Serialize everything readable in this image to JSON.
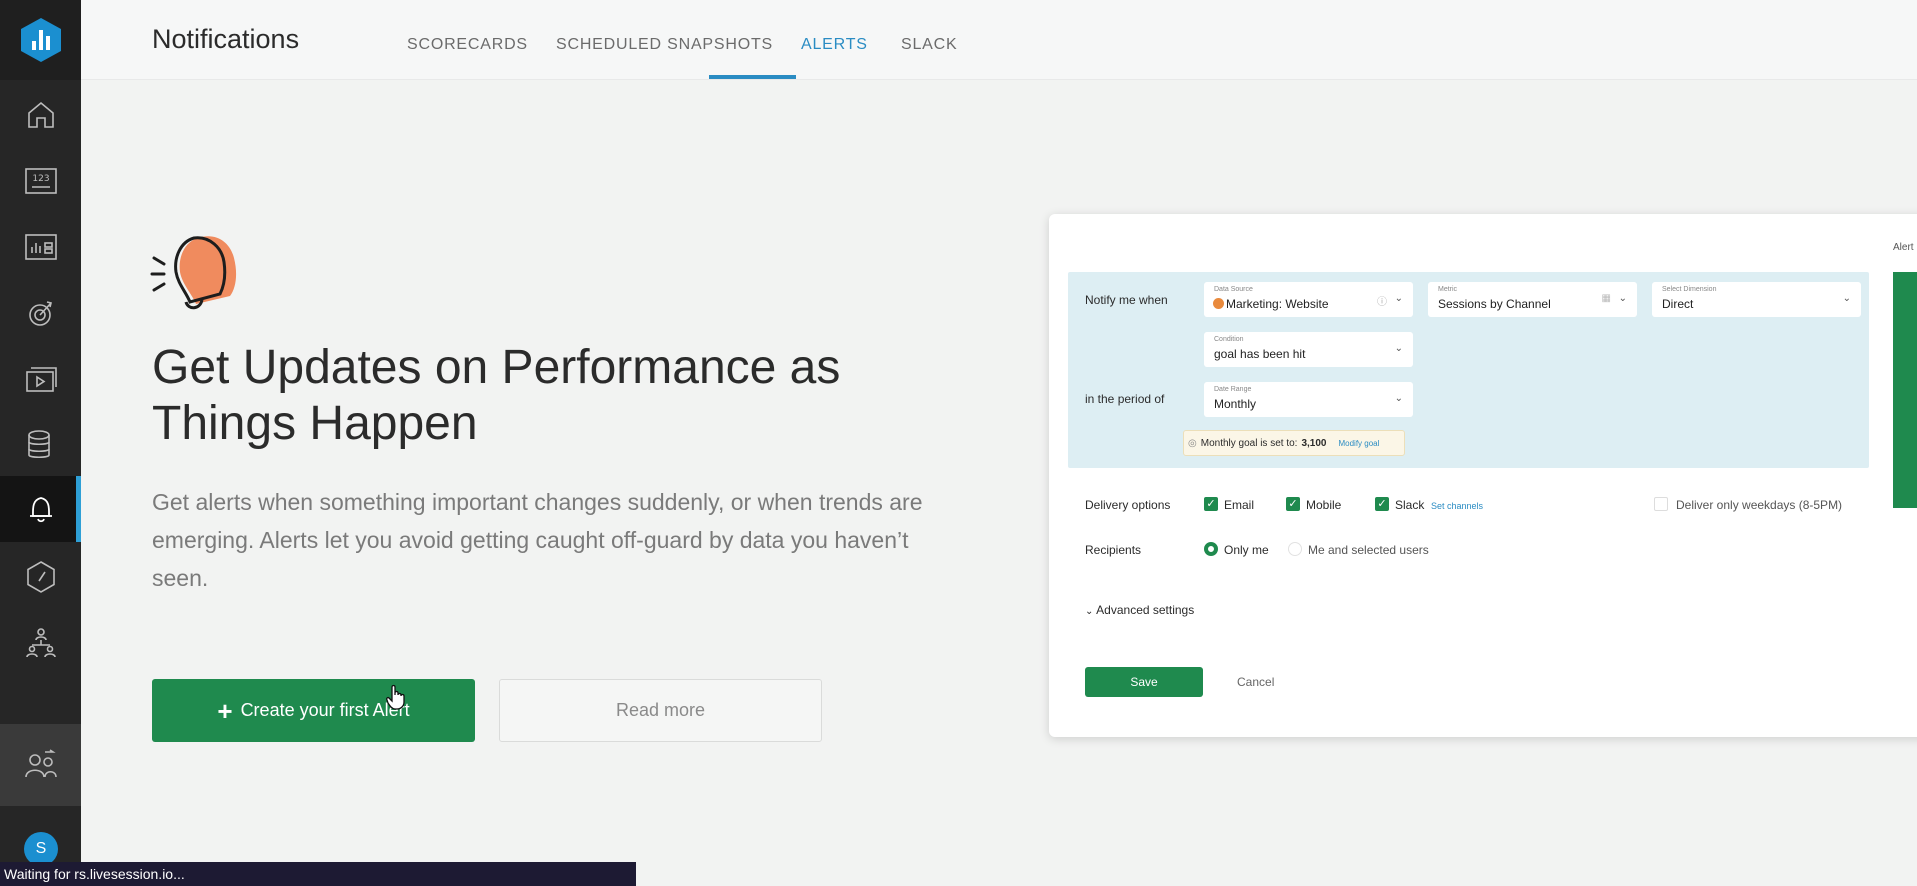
{
  "header": {
    "title": "Notifications",
    "tabs": [
      {
        "label": "SCORECARDS"
      },
      {
        "label": "SCHEDULED SNAPSHOTS"
      },
      {
        "label": "ALERTS"
      },
      {
        "label": "SLACK"
      }
    ],
    "active_tab": "ALERTS"
  },
  "sidebar": {
    "items": [
      "home-icon",
      "number-icon",
      "dashboard-icon",
      "goal-icon",
      "media-icon",
      "database-icon",
      "bell-icon",
      "gauge-icon",
      "org-chart-icon",
      "people-icon"
    ],
    "active": "bell-icon",
    "avatar_initial": "S"
  },
  "hero": {
    "title_line1": "Get Updates on Performance as",
    "title_line2": "Things Happen",
    "description": "Get alerts when something important changes suddenly, or when trends are emerging. Alerts let you avoid getting caught off-guard by data you haven’t seen.",
    "primary_button": "Create your first Alert",
    "secondary_button": "Read more"
  },
  "preview": {
    "notify_label": "Notify me when",
    "period_label": "in the period of",
    "data_source": {
      "label": "Data Source",
      "value": "Marketing: Website"
    },
    "metric": {
      "label": "Metric",
      "value": "Sessions by Channel"
    },
    "dimension": {
      "label": "Select Dimension",
      "value": "Direct"
    },
    "condition": {
      "label": "Condition",
      "value": "goal has been hit"
    },
    "date_range": {
      "label": "Date Range",
      "value": "Monthly"
    },
    "goal_note": "Monthly goal is set to:",
    "goal_value": "3,100",
    "modify_goal": "Modify goal",
    "delivery_label": "Delivery options",
    "delivery": {
      "email": "Email",
      "mobile": "Mobile",
      "slack": "Slack"
    },
    "set_channels": "Set channels",
    "weekdays": "Deliver only weekdays (8-5PM)",
    "recipients_label": "Recipients",
    "only_me": "Only me",
    "selected_users": "Me and selected users",
    "advanced": "Advanced settings",
    "save": "Save",
    "cancel": "Cancel",
    "peek_label": "Alert"
  },
  "status_bar": "Waiting for rs.livesession.io...",
  "colors": {
    "accent": "#2a8cc3",
    "primary": "#1f8a4e",
    "sidebar": "#262626"
  }
}
